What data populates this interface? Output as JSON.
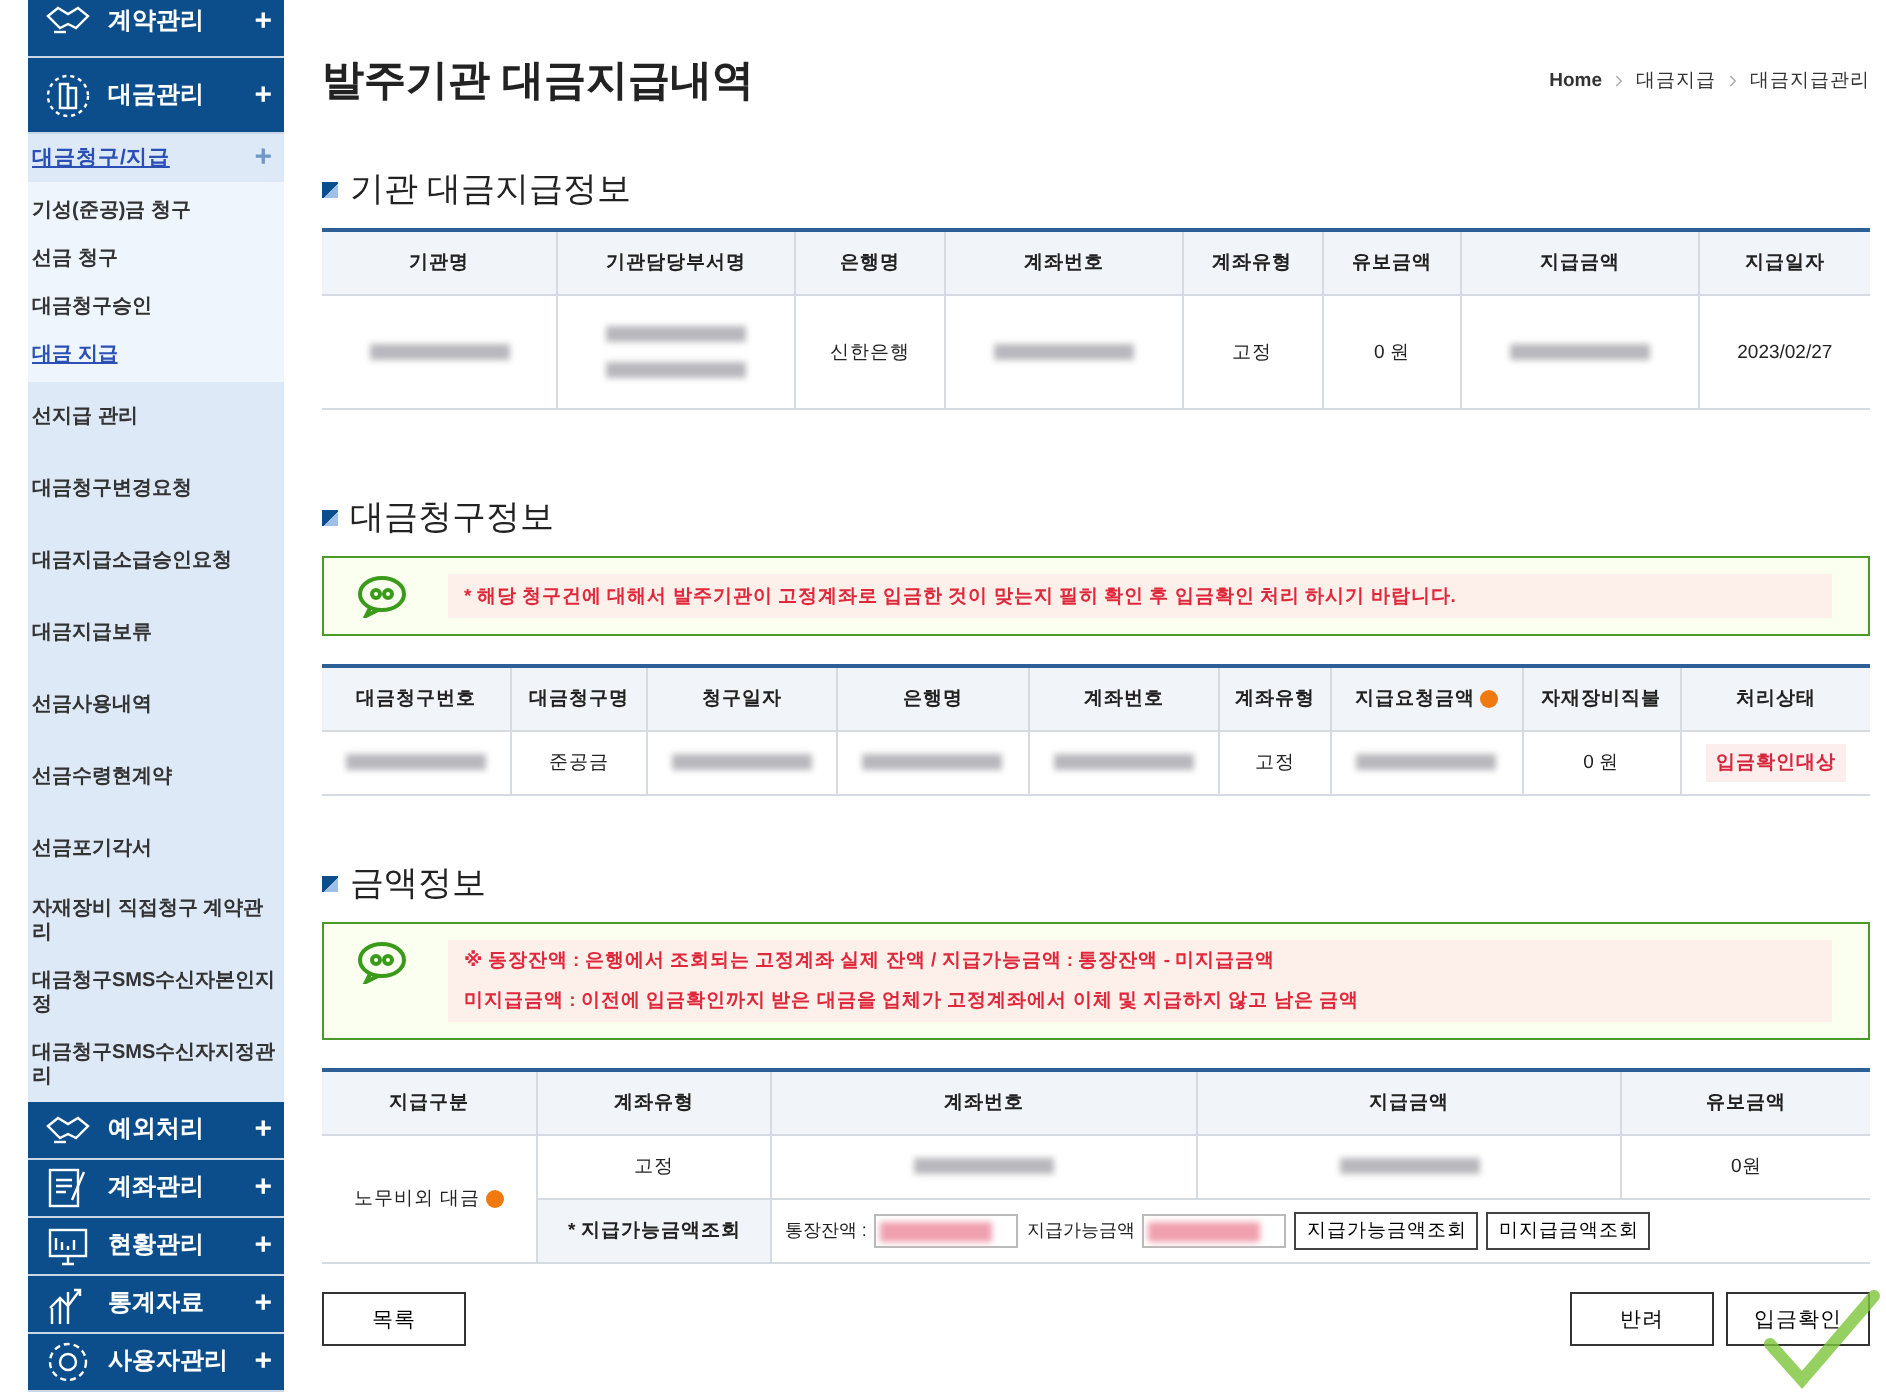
{
  "sidebar": [
    {
      "label": "계약관리",
      "sign": "+",
      "expanded": false
    },
    {
      "label": "대금관리",
      "sign": "+",
      "expanded": true,
      "children": [
        {
          "label": "대금청구/지급",
          "sign": "+",
          "selected": true,
          "children": [
            {
              "label": "기성(준공)금 청구",
              "selected": false
            },
            {
              "label": "선금 청구",
              "selected": false
            },
            {
              "label": "대금청구승인",
              "selected": false
            },
            {
              "label": "대금 지급",
              "selected": true
            }
          ]
        },
        {
          "label": "선지급 관리",
          "selected": false
        },
        {
          "label": "대금청구변경요청",
          "selected": false
        },
        {
          "label": "대금지급소급승인요청",
          "selected": false
        },
        {
          "label": "대금지급보류",
          "selected": false
        },
        {
          "label": "선금사용내역",
          "selected": false
        },
        {
          "label": "선금수령현계약",
          "selected": false
        },
        {
          "label": "선금포기각서",
          "selected": false
        },
        {
          "label": "자재장비 직접청구 계약관리",
          "selected": false
        },
        {
          "label": "대금청구SMS수신자본인지정",
          "selected": false
        },
        {
          "label": "대금청구SMS수신자지정관리",
          "selected": false
        }
      ]
    },
    {
      "label": "예외처리",
      "sign": "+",
      "expanded": false
    },
    {
      "label": "계좌관리",
      "sign": "+",
      "expanded": false
    },
    {
      "label": "현황관리",
      "sign": "+",
      "expanded": false
    },
    {
      "label": "통계자료",
      "sign": "+",
      "expanded": false
    },
    {
      "label": "사용자관리",
      "sign": "+",
      "expanded": false
    }
  ],
  "title": "발주기관 대금지급내역",
  "breadcrumb": [
    "Home",
    "대금지급",
    "대금지급관리"
  ],
  "payment_info": {
    "heading": "기관 대금지급정보",
    "columns": [
      {
        "label": "기관명",
        "help": false
      },
      {
        "label": "기관담당부서명",
        "help": false
      },
      {
        "label": "은행명",
        "help": false
      },
      {
        "label": "계좌번호",
        "help": false
      },
      {
        "label": "계좌유형",
        "help": false
      },
      {
        "label": "유보금액",
        "help": false
      },
      {
        "label": "지급금액",
        "help": false
      },
      {
        "label": "지급일자",
        "help": false
      }
    ],
    "rows": [
      [
        {
          "kind": "redacted"
        },
        {
          "kind": "redacted_multi"
        },
        {
          "kind": "text",
          "text": "신한은행"
        },
        {
          "kind": "redacted"
        },
        {
          "kind": "text",
          "text": "고정"
        },
        {
          "kind": "text",
          "text": "0 원"
        },
        {
          "kind": "redacted"
        },
        {
          "kind": "text",
          "text": "2023/02/27"
        }
      ]
    ]
  },
  "claim_info": {
    "heading": "대금청구정보",
    "notice": [
      "* 해당 청구건에 대해서 발주기관이 고정계좌로 입금한 것이 맞는지 필히 확인 후 입금확인 처리 하시기 바랍니다."
    ],
    "columns": [
      {
        "label": "대금청구번호",
        "help": false
      },
      {
        "label": "대금청구명",
        "help": false
      },
      {
        "label": "청구일자",
        "help": false
      },
      {
        "label": "은행명",
        "help": false
      },
      {
        "label": "계좌번호",
        "help": false
      },
      {
        "label": "계좌유형",
        "help": false
      },
      {
        "label": "지급요청금액",
        "help": true
      },
      {
        "label": "자재장비직불",
        "help": false
      },
      {
        "label": "처리상태",
        "help": false
      }
    ],
    "rows": [
      [
        {
          "kind": "redacted"
        },
        {
          "kind": "text",
          "text": "준공금"
        },
        {
          "kind": "redacted"
        },
        {
          "kind": "redacted"
        },
        {
          "kind": "redacted"
        },
        {
          "kind": "text",
          "text": "고정"
        },
        {
          "kind": "redacted"
        },
        {
          "kind": "text",
          "text": "0 원"
        },
        {
          "kind": "badge",
          "text": "입금확인대상"
        }
      ]
    ]
  },
  "amount_info": {
    "heading": "금액정보",
    "notice": [
      "※ 동장잔액 : 은행에서 조회되는 고정계좌 실제 잔액 / 지급가능금액 : 통장잔액 - 미지급금액",
      "미지급금액 : 이전에 입금확인까지 받은 대금을 업체가 고정계좌에서 이체 및 지급하지 않고 남은 금액"
    ],
    "columns": [
      "지급구분",
      "계좌유형",
      "계좌번호",
      "지급금액",
      "유보금액"
    ],
    "category": "노무비외 대금",
    "account_type": "고정",
    "reserved": "0원",
    "lookup_label": "* 지급가능금액조회",
    "balance_label": "통장잔액 :",
    "available_label": "지급가능금액",
    "lookup_buttons": [
      "지급가능금액조회",
      "미지급금액조회"
    ]
  },
  "footer": {
    "list_button": "목록",
    "actions": [
      "반려",
      "입금확인"
    ]
  }
}
